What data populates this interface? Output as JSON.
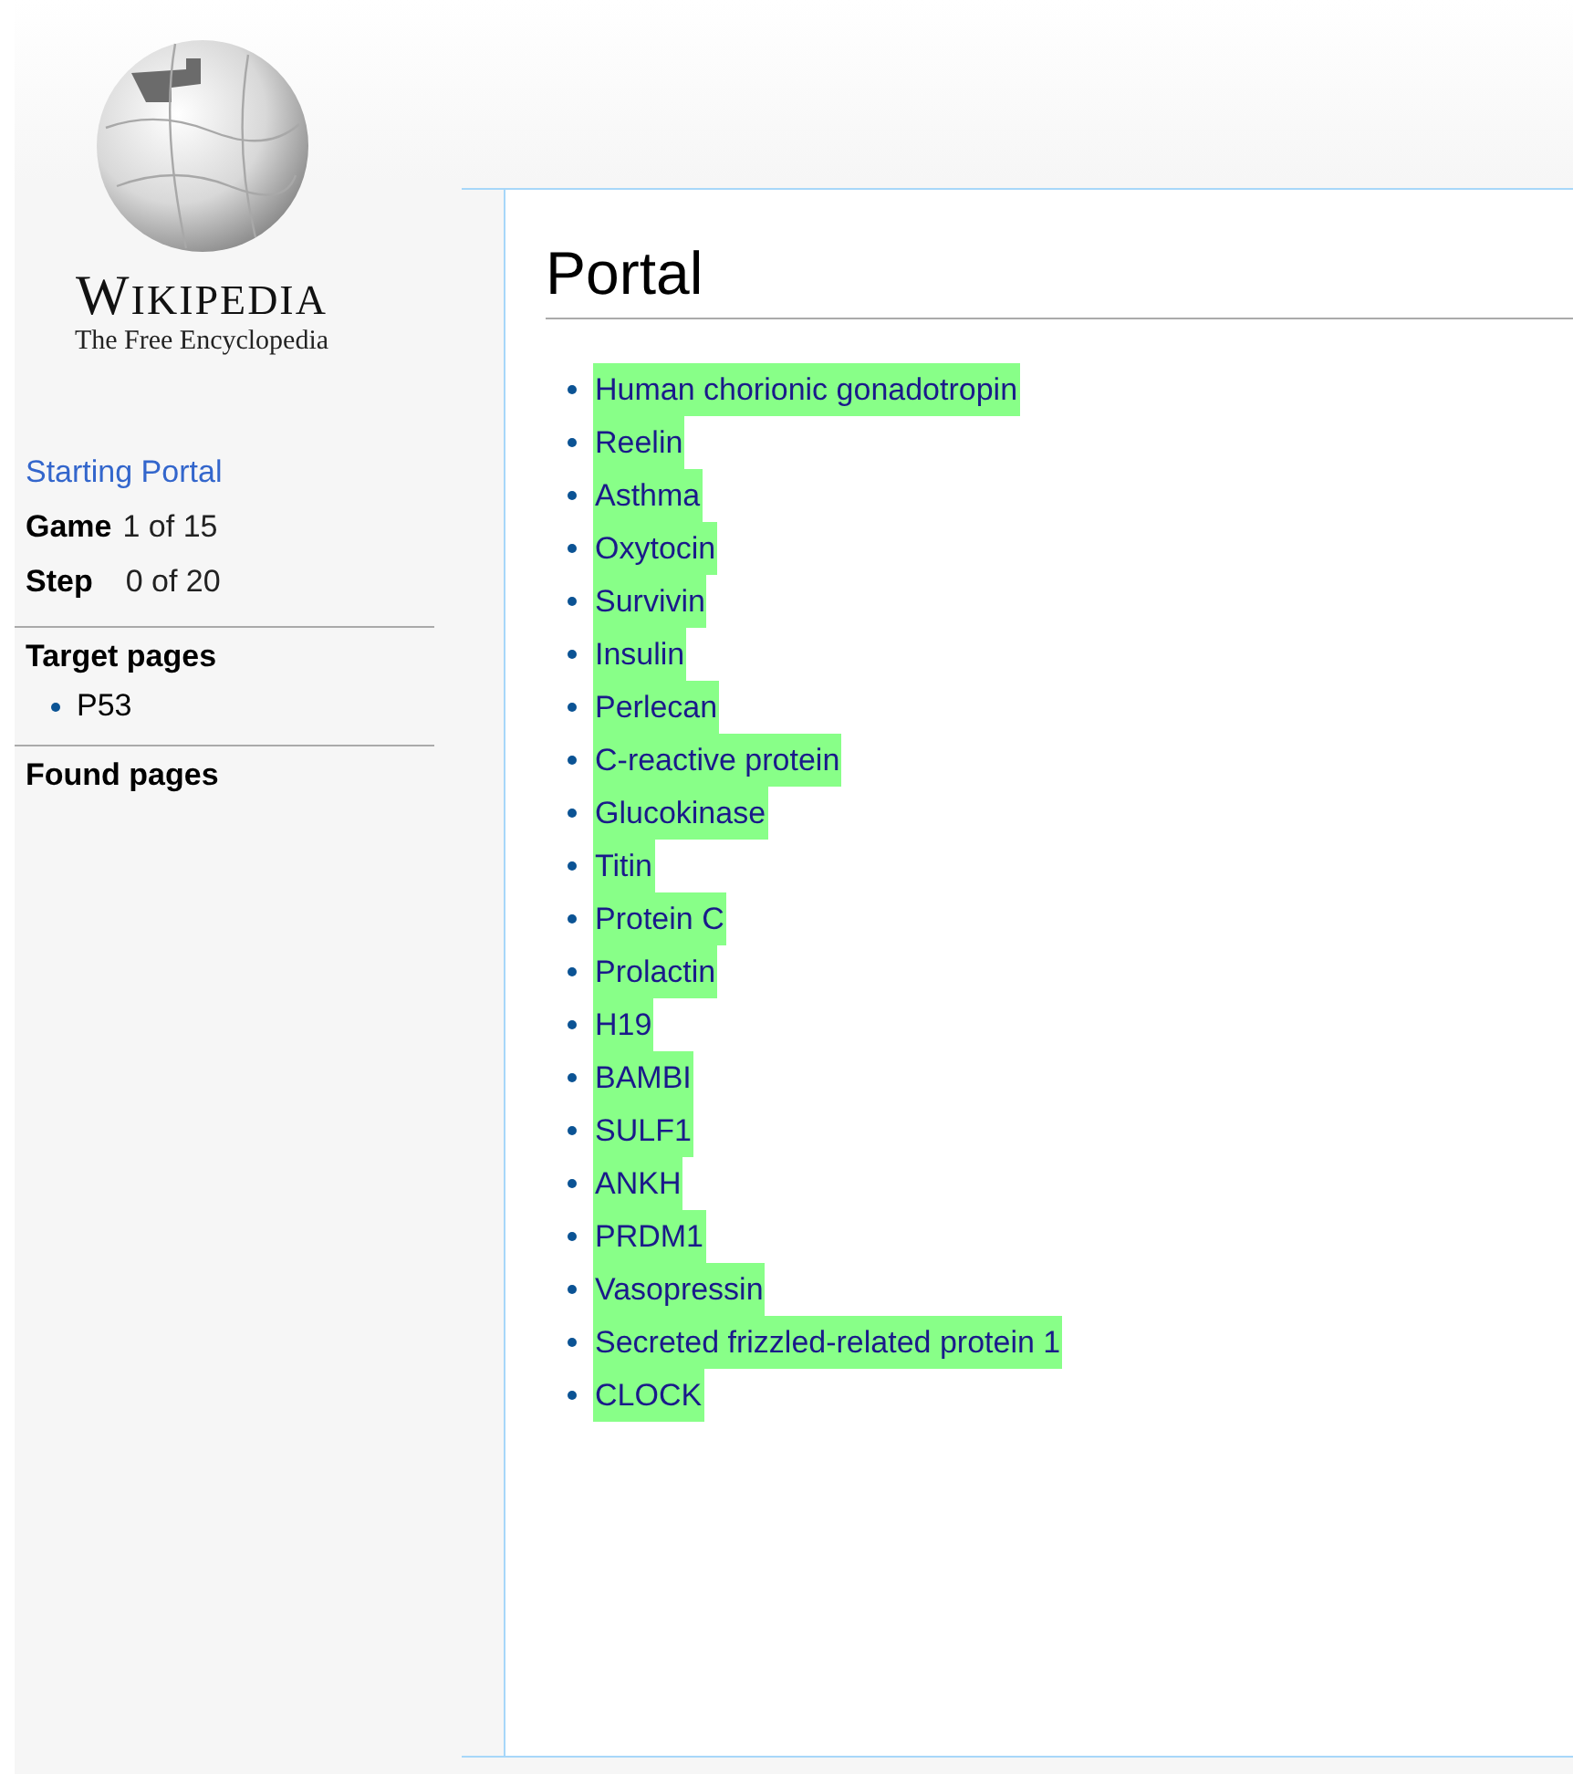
{
  "logo": {
    "wordmark": "WIKIPEDIA",
    "tagline": "The Free Encyclopedia"
  },
  "sidebar": {
    "start_link": "Starting Portal",
    "stats": [
      {
        "label": "Game",
        "value": "1 of 15"
      },
      {
        "label": "Step",
        "value": "0 of 20"
      }
    ],
    "target_heading": "Target pages",
    "targets": [
      "P53"
    ],
    "found_heading": "Found pages"
  },
  "page": {
    "title": "Portal",
    "links": [
      {
        "text": "Human chorionic gonadotropin",
        "highlighted": true
      },
      {
        "text": "Reelin",
        "highlighted": true
      },
      {
        "text": "Asthma",
        "highlighted": true
      },
      {
        "text": "Oxytocin",
        "highlighted": true
      },
      {
        "text": "Survivin",
        "highlighted": true
      },
      {
        "text": "Insulin",
        "highlighted": true
      },
      {
        "text": "Perlecan",
        "highlighted": true
      },
      {
        "text": "C-reactive protein",
        "highlighted": true
      },
      {
        "text": "Glucokinase",
        "highlighted": true
      },
      {
        "text": "Titin",
        "highlighted": true
      },
      {
        "text": "Protein C",
        "highlighted": true
      },
      {
        "text": "Prolactin",
        "highlighted": true
      },
      {
        "text": "H19",
        "highlighted": true
      },
      {
        "text": "BAMBI",
        "highlighted": true
      },
      {
        "text": "SULF1",
        "highlighted": true
      },
      {
        "text": "ANKH",
        "highlighted": true
      },
      {
        "text": "PRDM1",
        "highlighted": true
      },
      {
        "text": "Vasopressin",
        "highlighted": true
      },
      {
        "text": "Secreted frizzled-related protein 1",
        "highlighted": true
      },
      {
        "text": "CLOCK",
        "highlighted": true
      }
    ]
  }
}
